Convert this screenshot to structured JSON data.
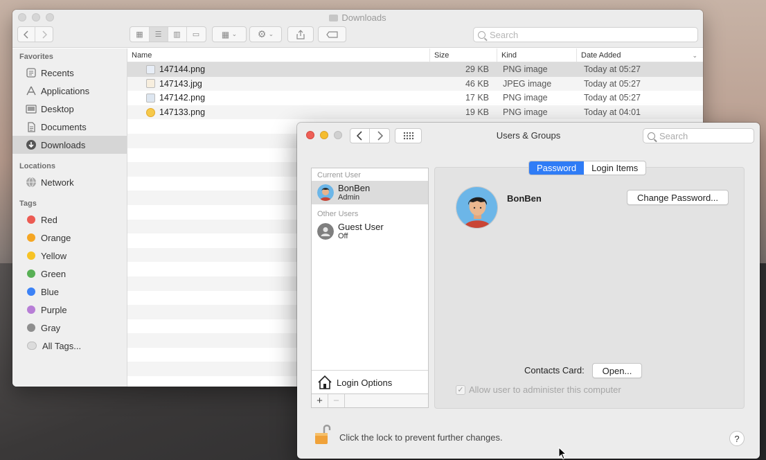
{
  "finder": {
    "title": "Downloads",
    "search_placeholder": "Search",
    "sidebar": {
      "favorites_heading": "Favorites",
      "favorites": [
        {
          "label": "Recents",
          "icon": "clock-icon"
        },
        {
          "label": "Applications",
          "icon": "applications-icon"
        },
        {
          "label": "Desktop",
          "icon": "desktop-icon"
        },
        {
          "label": "Documents",
          "icon": "documents-icon"
        },
        {
          "label": "Downloads",
          "icon": "downloads-icon",
          "selected": true
        }
      ],
      "locations_heading": "Locations",
      "locations": [
        {
          "label": "Network",
          "icon": "globe-icon"
        }
      ],
      "tags_heading": "Tags",
      "tags": [
        {
          "label": "Red",
          "color": "#ec5b53"
        },
        {
          "label": "Orange",
          "color": "#f5a623"
        },
        {
          "label": "Yellow",
          "color": "#f7c325"
        },
        {
          "label": "Green",
          "color": "#58b055"
        },
        {
          "label": "Blue",
          "color": "#3c82f6"
        },
        {
          "label": "Purple",
          "color": "#b77ed6"
        },
        {
          "label": "Gray",
          "color": "#8e8e8e"
        },
        {
          "label": "All Tags...",
          "color": "#dcdcdc"
        }
      ]
    },
    "columns": {
      "name": "Name",
      "size": "Size",
      "kind": "Kind",
      "date": "Date Added"
    },
    "files": [
      {
        "name": "147144.png",
        "size": "29 KB",
        "kind": "PNG image",
        "date": "Today at 05:27",
        "selected": true
      },
      {
        "name": "147143.jpg",
        "size": "46 KB",
        "kind": "JPEG image",
        "date": "Today at 05:27"
      },
      {
        "name": "147142.png",
        "size": "17 KB",
        "kind": "PNG image",
        "date": "Today at 05:27"
      },
      {
        "name": "147133.png",
        "size": "19 KB",
        "kind": "PNG image",
        "date": "Today at 04:01"
      }
    ]
  },
  "prefs": {
    "title": "Users & Groups",
    "search_placeholder": "Search",
    "current_user_heading": "Current User",
    "other_users_heading": "Other Users",
    "users": [
      {
        "name": "BonBen",
        "role": "Admin",
        "selected": true
      },
      {
        "name": "Guest User",
        "role": "Off"
      }
    ],
    "login_options": "Login Options",
    "add_symbol": "+",
    "remove_symbol": "−",
    "tabs": [
      "Password",
      "Login Items"
    ],
    "active_tab": "Password",
    "user_name": "BonBen",
    "change_password": "Change Password...",
    "contacts_card_label": "Contacts Card:",
    "open_button": "Open...",
    "allow_admin_label": "Allow user to administer this computer",
    "allow_admin_checked": true,
    "lock_text": "Click the lock to prevent further changes.",
    "help_symbol": "?"
  }
}
